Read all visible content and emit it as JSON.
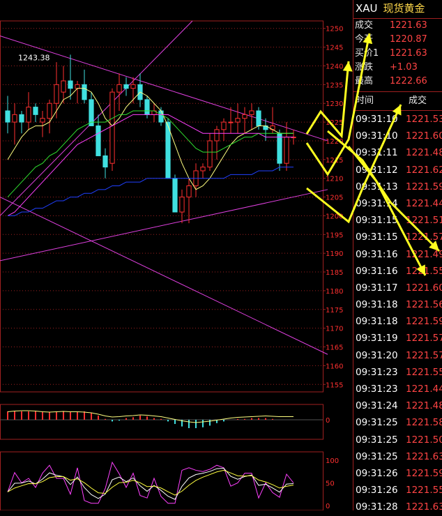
{
  "chart_data": {
    "type": "candlestick",
    "price_axis": {
      "ticks": [
        1250,
        1245,
        1240,
        1235,
        1230,
        1225,
        1220,
        1215,
        1210,
        1205,
        1200,
        1195,
        1190,
        1185,
        1180,
        1175,
        1170,
        1165,
        1160,
        1155
      ],
      "ylim": [
        1153,
        1252
      ]
    },
    "annotation": "1243.38",
    "candles": [
      {
        "o": 1228,
        "h": 1232,
        "l": 1222,
        "c": 1225
      },
      {
        "o": 1225,
        "h": 1230,
        "l": 1219,
        "c": 1227
      },
      {
        "o": 1227,
        "h": 1228,
        "l": 1222,
        "c": 1225
      },
      {
        "o": 1225,
        "h": 1233,
        "l": 1223,
        "c": 1229
      },
      {
        "o": 1229,
        "h": 1230,
        "l": 1225,
        "c": 1227
      },
      {
        "o": 1225,
        "h": 1228,
        "l": 1221,
        "c": 1226
      },
      {
        "o": 1226,
        "h": 1231,
        "l": 1222,
        "c": 1230
      },
      {
        "o": 1230,
        "h": 1241,
        "l": 1226,
        "c": 1235
      },
      {
        "o": 1233,
        "h": 1240,
        "l": 1230,
        "c": 1236
      },
      {
        "o": 1236,
        "h": 1243,
        "l": 1231,
        "c": 1234
      },
      {
        "o": 1234,
        "h": 1236,
        "l": 1230,
        "c": 1235
      },
      {
        "o": 1235,
        "h": 1239,
        "l": 1230,
        "c": 1231
      },
      {
        "o": 1231,
        "h": 1233,
        "l": 1224,
        "c": 1224
      },
      {
        "o": 1224,
        "h": 1227,
        "l": 1218,
        "c": 1216
      },
      {
        "o": 1216,
        "h": 1218,
        "l": 1210,
        "c": 1213
      },
      {
        "o": 1214,
        "h": 1234,
        "l": 1212,
        "c": 1233
      },
      {
        "o": 1233,
        "h": 1238,
        "l": 1228,
        "c": 1235
      },
      {
        "o": 1235,
        "h": 1237,
        "l": 1232,
        "c": 1234
      },
      {
        "o": 1234,
        "h": 1237,
        "l": 1230,
        "c": 1235
      },
      {
        "o": 1235,
        "h": 1238,
        "l": 1229,
        "c": 1231
      },
      {
        "o": 1231,
        "h": 1232,
        "l": 1226,
        "c": 1227
      },
      {
        "o": 1227,
        "h": 1230,
        "l": 1225,
        "c": 1228
      },
      {
        "o": 1228,
        "h": 1229,
        "l": 1224,
        "c": 1225
      },
      {
        "o": 1225,
        "h": 1226,
        "l": 1210,
        "c": 1210
      },
      {
        "o": 1210,
        "h": 1211,
        "l": 1201,
        "c": 1201
      },
      {
        "o": 1201,
        "h": 1207,
        "l": 1198,
        "c": 1205
      },
      {
        "o": 1205,
        "h": 1210,
        "l": 1198,
        "c": 1208
      },
      {
        "o": 1208,
        "h": 1214,
        "l": 1205,
        "c": 1212
      },
      {
        "o": 1212,
        "h": 1214,
        "l": 1210,
        "c": 1213
      },
      {
        "o": 1213,
        "h": 1222,
        "l": 1212,
        "c": 1220
      },
      {
        "o": 1220,
        "h": 1224,
        "l": 1215,
        "c": 1223
      },
      {
        "o": 1223,
        "h": 1226,
        "l": 1220,
        "c": 1225
      },
      {
        "o": 1225,
        "h": 1229,
        "l": 1222,
        "c": 1225
      },
      {
        "o": 1225,
        "h": 1230,
        "l": 1222,
        "c": 1226
      },
      {
        "o": 1226,
        "h": 1229,
        "l": 1222,
        "c": 1227
      },
      {
        "o": 1227,
        "h": 1230,
        "l": 1223,
        "c": 1228
      },
      {
        "o": 1228,
        "h": 1229,
        "l": 1223,
        "c": 1224
      },
      {
        "o": 1224,
        "h": 1226,
        "l": 1220,
        "c": 1223
      },
      {
        "o": 1223,
        "h": 1229,
        "l": 1222,
        "c": 1224
      },
      {
        "o": 1222,
        "h": 1223,
        "l": 1212,
        "c": 1214
      },
      {
        "o": 1214,
        "h": 1225,
        "l": 1212,
        "c": 1221
      },
      {
        "o": 1221,
        "h": 1223,
        "l": 1219,
        "c": 1221
      }
    ],
    "ma_series": [
      {
        "color": "#ffff80",
        "values": [
          1215,
          1218,
          1221,
          1223,
          1224,
          1224,
          1225,
          1228,
          1231,
          1232,
          1234,
          1234,
          1233,
          1230,
          1226,
          1224,
          1226,
          1229,
          1231,
          1233,
          1232,
          1230,
          1228,
          1224,
          1219,
          1214,
          1210,
          1207,
          1208,
          1210,
          1213,
          1216,
          1219,
          1221,
          1222,
          1223,
          1224,
          1224,
          1223,
          1222,
          1222,
          1222
        ]
      },
      {
        "color": "#30e030",
        "values": [
          1205,
          1207,
          1209,
          1211,
          1213,
          1214,
          1216,
          1217,
          1219,
          1221,
          1223,
          1224,
          1225,
          1225,
          1225,
          1226,
          1227,
          1227,
          1228,
          1228,
          1228,
          1228,
          1227,
          1226,
          1224,
          1222,
          1220,
          1218,
          1217,
          1217,
          1217,
          1218,
          1219,
          1220,
          1221,
          1221,
          1222,
          1222,
          1222,
          1222,
          1222,
          1222
        ]
      },
      {
        "color": "#ff40ff",
        "values": [
          1200,
          1201,
          1203,
          1205,
          1207,
          1209,
          1211,
          1213,
          1215,
          1217,
          1219,
          1220,
          1221,
          1222,
          1223,
          1224,
          1225,
          1226,
          1227,
          1227,
          1227,
          1227,
          1227,
          1227,
          1226,
          1225,
          1224,
          1223,
          1222,
          1222,
          1222,
          1222,
          1222,
          1222,
          1222,
          1222,
          1222,
          1221,
          1221,
          1221,
          1221,
          1221
        ]
      },
      {
        "color": "#2040ff",
        "values": [
          1200,
          1200,
          1201,
          1201,
          1202,
          1202,
          1203,
          1204,
          1204,
          1205,
          1205,
          1206,
          1206,
          1207,
          1207,
          1208,
          1208,
          1209,
          1209,
          1209,
          1210,
          1210,
          1210,
          1210,
          1210,
          1210,
          1210,
          1210,
          1210,
          1210,
          1210,
          1210,
          1211,
          1211,
          1211,
          1211,
          1212,
          1212,
          1212,
          1213,
          1213,
          1213
        ]
      }
    ],
    "trend_lines": [
      {
        "color": "#e040e0",
        "from": [
          0,
          1248
        ],
        "to": [
          470,
          1220
        ]
      },
      {
        "color": "#e040e0",
        "from": [
          0,
          1205
        ],
        "to": [
          470,
          1163
        ]
      },
      {
        "color": "#e040e0",
        "from": [
          0,
          1188
        ],
        "to": [
          470,
          1207
        ]
      },
      {
        "color": "#e040e0",
        "from": [
          0,
          1200
        ],
        "to": [
          276,
          1252
        ]
      }
    ],
    "macd_axis": {
      "label": "0"
    },
    "kdj_axis": {
      "ticks": [
        100,
        50,
        0
      ]
    }
  },
  "panel": {
    "symbol": "XAU",
    "name": "现货黄金",
    "quote": [
      {
        "label": "成交",
        "value": "1221.63"
      },
      {
        "label": "今开",
        "value": "1220.87"
      },
      {
        "label": "买价1",
        "value": "1221.63"
      },
      {
        "label": "涨跌",
        "value": "+1.03"
      },
      {
        "label": "最高",
        "value": "1222.66"
      }
    ],
    "trades_header": {
      "time": "时间",
      "price": "成交"
    },
    "trades": [
      {
        "t": "09:31:10",
        "p": "1221.53"
      },
      {
        "t": "09:31:10",
        "p": "1221.60"
      },
      {
        "t": "09:31:11",
        "p": "1221.48"
      },
      {
        "t": "09:31:12",
        "p": "1221.62"
      },
      {
        "t": "09:31:13",
        "p": "1221.59"
      },
      {
        "t": "09:31:14",
        "p": "1221.44"
      },
      {
        "t": "09:31:15",
        "p": "1221.51"
      },
      {
        "t": "09:31:15",
        "p": "1221.57"
      },
      {
        "t": "09:31:16",
        "p": "1221.49"
      },
      {
        "t": "09:31:16",
        "p": "1221.55"
      },
      {
        "t": "09:31:17",
        "p": "1221.60"
      },
      {
        "t": "09:31:18",
        "p": "1221.56"
      },
      {
        "t": "09:31:18",
        "p": "1221.59"
      },
      {
        "t": "09:31:19",
        "p": "1221.57"
      },
      {
        "t": "09:31:20",
        "p": "1221.57"
      },
      {
        "t": "09:31:23",
        "p": "1221.55"
      },
      {
        "t": "09:31:23",
        "p": "1221.44"
      },
      {
        "t": "09:31:24",
        "p": "1221.48"
      },
      {
        "t": "09:31:25",
        "p": "1221.58"
      },
      {
        "t": "09:31:25",
        "p": "1221.50"
      },
      {
        "t": "09:31:25",
        "p": "1221.63"
      },
      {
        "t": "09:31:26",
        "p": "1221.59"
      },
      {
        "t": "09:31:26",
        "p": "1221.55"
      },
      {
        "t": "09:31:28",
        "p": "1221.63"
      }
    ]
  },
  "colors": {
    "up": "#ff3030",
    "down": "#40e0e0",
    "grid": "#a02020",
    "arrow": "#ffff20"
  }
}
